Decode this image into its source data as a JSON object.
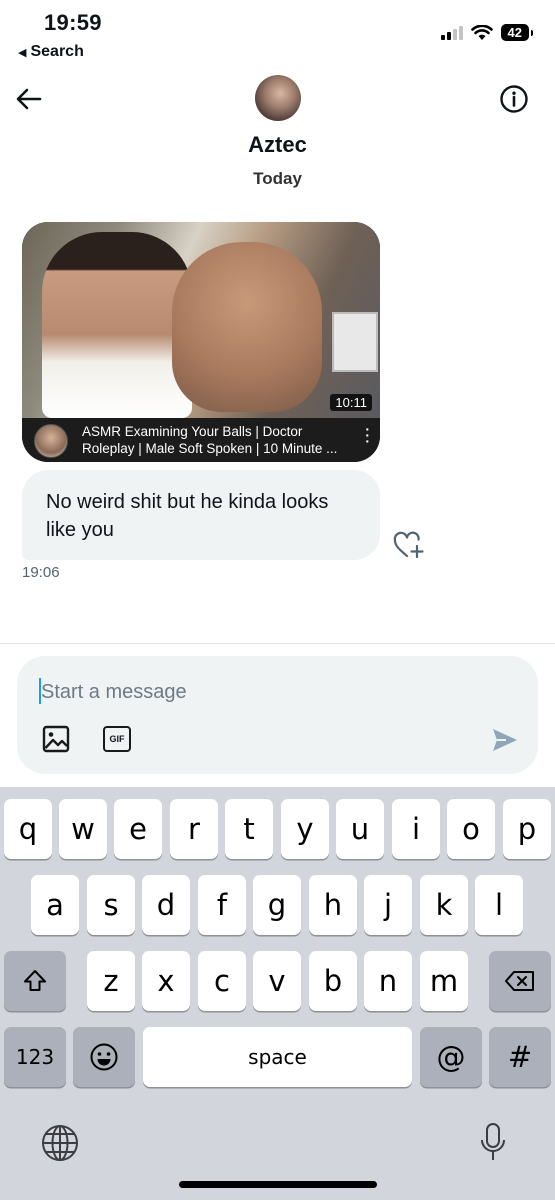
{
  "status_bar": {
    "time": "19:59",
    "back_app": "Search",
    "battery": "42"
  },
  "header": {
    "contact_name": "Aztec",
    "date_label": "Today"
  },
  "messages": {
    "video": {
      "duration": "10:11",
      "title": "ASMR Examining Your Balls | Doctor Roleplay | Male Soft Spoken | 10 Minute ..."
    },
    "text": "No weird shit but he kinda looks like you",
    "timestamp": "19:06"
  },
  "composer": {
    "placeholder": "Start a message",
    "gif_label": "GIF"
  },
  "keyboard": {
    "row1": [
      "q",
      "w",
      "e",
      "r",
      "t",
      "y",
      "u",
      "i",
      "o",
      "p"
    ],
    "row2": [
      "a",
      "s",
      "d",
      "f",
      "g",
      "h",
      "j",
      "k",
      "l"
    ],
    "row3": [
      "z",
      "x",
      "c",
      "v",
      "b",
      "n",
      "m"
    ],
    "numbers_key": "123",
    "space_key": "space",
    "at_key": "@",
    "hash_key": "#"
  },
  "colors": {
    "accent": "#1d9bf0",
    "bubble": "#eff3f4",
    "keyboard_bg": "#d2d5db",
    "send_icon": "#8fa6b8"
  }
}
